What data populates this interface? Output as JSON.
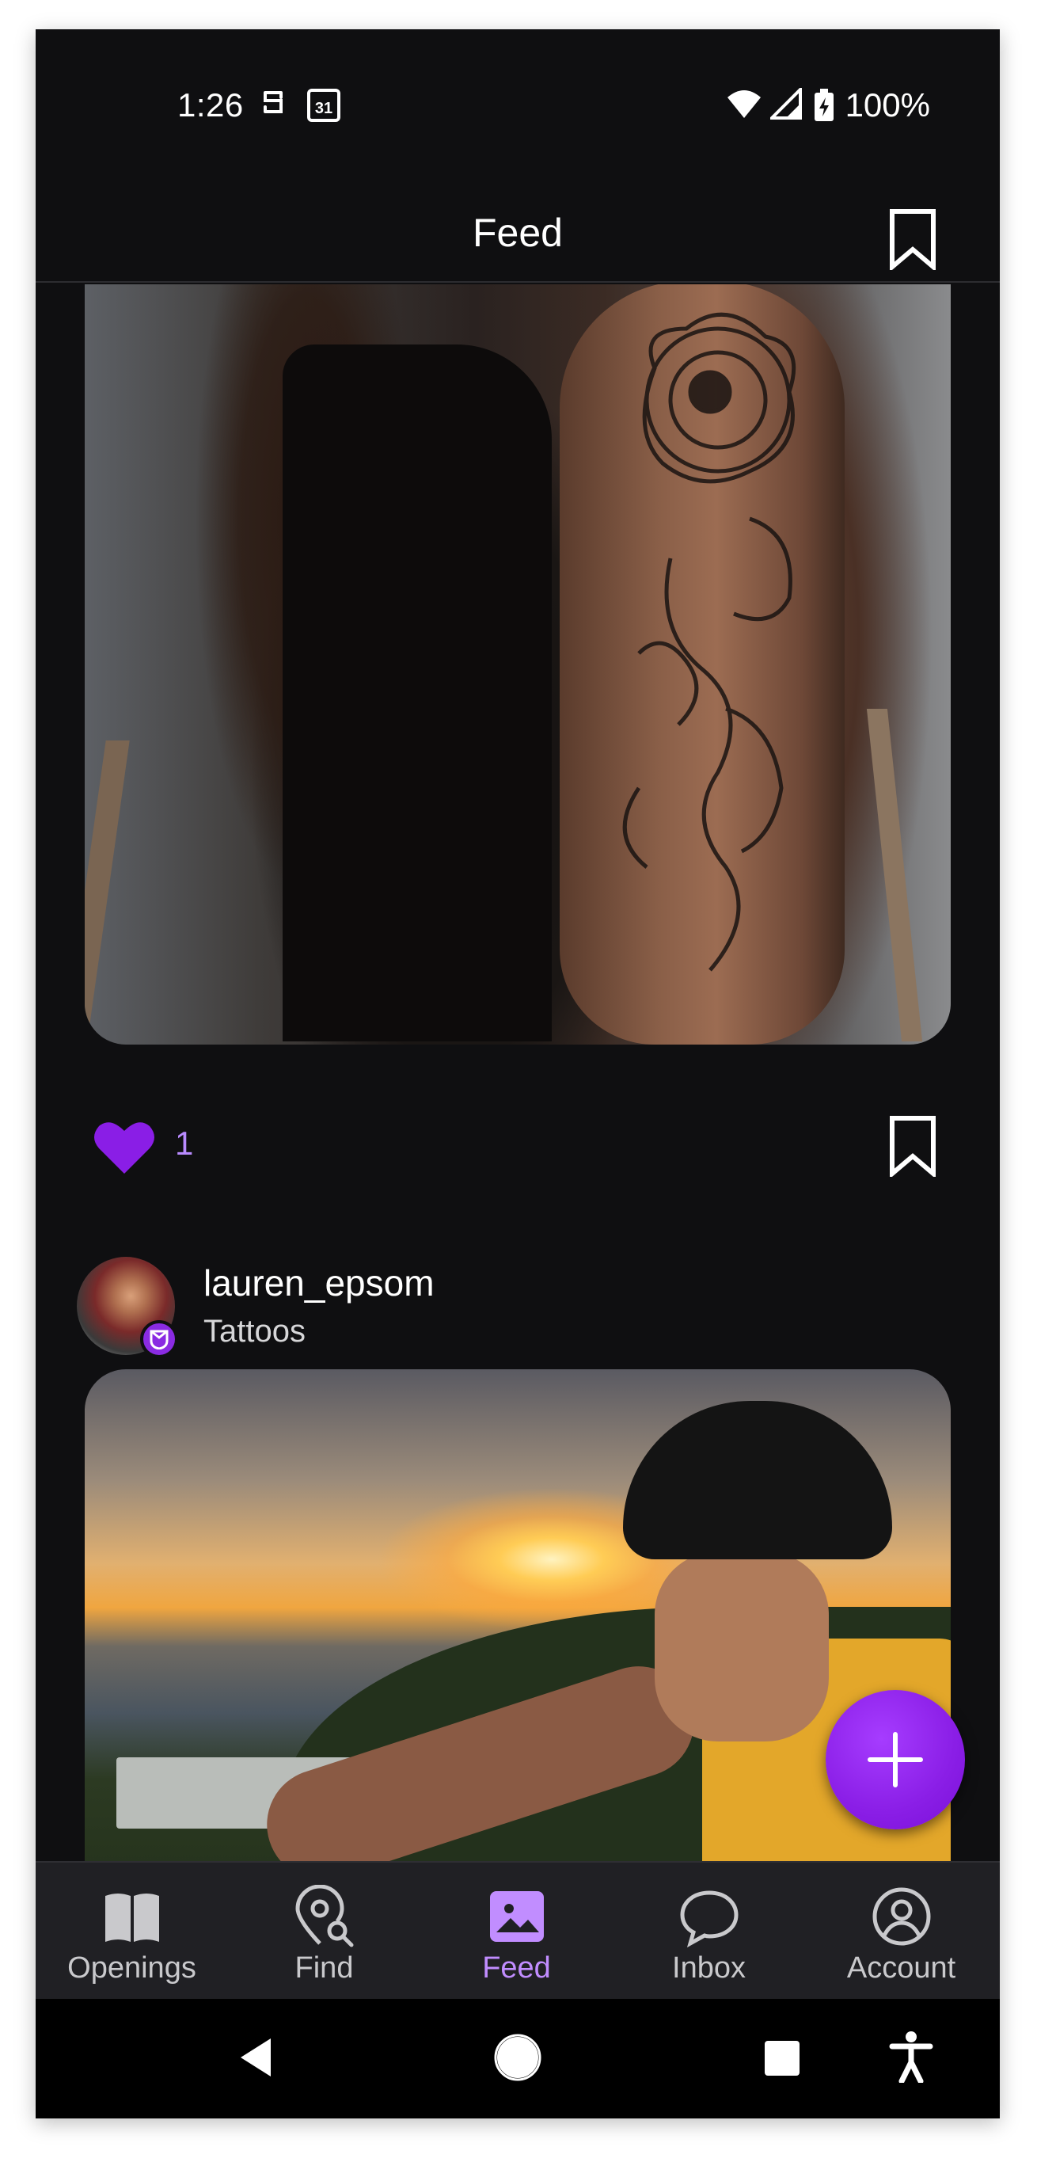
{
  "status_bar": {
    "time": "1:26",
    "battery_text": "100%",
    "icons": [
      "notification-s-icon",
      "calendar-31-icon",
      "wifi-icon",
      "signal-icon",
      "battery-charging-icon"
    ],
    "calendar_day": "31"
  },
  "app_bar": {
    "title": "Feed",
    "bookmark_icon": "bookmark-icon"
  },
  "posts": [
    {
      "image_desc_icon": "photo",
      "likes": "1",
      "liked": true,
      "like_color": "#8a1ee6"
    },
    {
      "username": "lauren_epsom",
      "category": "Tattoos",
      "badge_icon": "shield-badge-icon"
    }
  ],
  "fab": {
    "icon": "plus-icon",
    "color": "#8a1ee6"
  },
  "bottom_nav": {
    "items": [
      {
        "label": "Openings",
        "icon": "book-open-icon"
      },
      {
        "label": "Find",
        "icon": "location-search-icon"
      },
      {
        "label": "Feed",
        "icon": "image-icon",
        "active": true
      },
      {
        "label": "Inbox",
        "icon": "chat-bubble-icon"
      },
      {
        "label": "Account",
        "icon": "account-circle-icon"
      }
    ],
    "active_color": "#c18dff"
  },
  "system_nav": {
    "icons": [
      "back-icon",
      "home-icon",
      "recents-icon",
      "accessibility-icon"
    ]
  }
}
